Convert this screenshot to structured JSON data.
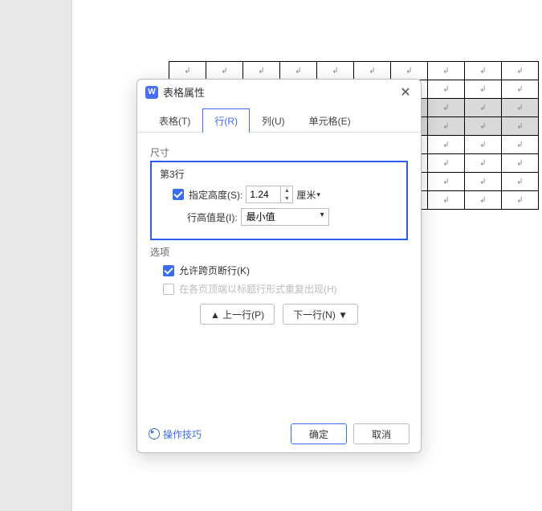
{
  "cell_mark": "↲",
  "dialog": {
    "title": "表格属性",
    "tabs": {
      "table": "表格(T)",
      "row": "行(R)",
      "column": "列(U)",
      "cell": "单元格(E)"
    },
    "size": {
      "group": "尺寸",
      "rowTitle": "第3行",
      "specifyHeight": "指定高度(S):",
      "heightValue": "1.24",
      "unit": "厘米",
      "rowHeightIs": "行高值是(I):",
      "ruleValue": "最小值"
    },
    "options": {
      "group": "选项",
      "breakAcross": "允许跨页断行(K)",
      "repeatHeader": "在各页顶端以标题行形式重复出现(H)"
    },
    "nav": {
      "prev": "▲ 上一行(P)",
      "next": "下一行(N) ▼"
    },
    "footer": {
      "tips": "操作技巧",
      "ok": "确定",
      "cancel": "取消"
    }
  }
}
